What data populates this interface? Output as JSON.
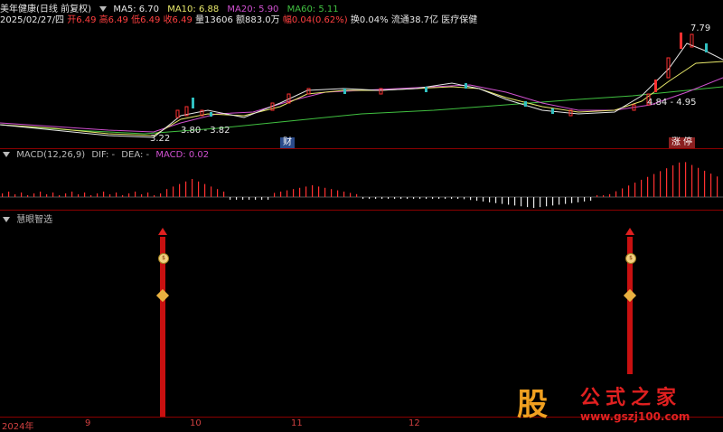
{
  "header": {
    "title": "美年健康(日线 前复权)",
    "ma5": "MA5: 6.70",
    "ma10": "MA10: 6.88",
    "ma20": "MA20: 5.90",
    "ma60": "MA60: 5.11",
    "date_line": "2025/02/27/四",
    "open": "开6.49",
    "high": "高6.49",
    "low": "低6.49",
    "close": "收6.49",
    "volume": "量13606",
    "amount": "额883.0万",
    "change": "幅0.04(0.62%)",
    "turnover": "换0.04%",
    "float": "流通38.7亿",
    "sector": "医疗保健"
  },
  "price_annotations": {
    "peak": "7.79",
    "low1": "3.22",
    "range1": "3.80 - 3.82",
    "range2": "4.84 - 4.95",
    "badge_cai": "财",
    "badge_zhangting": "涨",
    "badge_ting": "停"
  },
  "macd": {
    "label": "MACD(12,26,9)",
    "dif": "DIF: -",
    "dea": "DEA: -",
    "macd_value": "MACD: 0.02"
  },
  "indicator": {
    "label": "慧眼智选"
  },
  "x_axis": {
    "labels": [
      "2024年",
      "9",
      "10",
      "11",
      "12"
    ]
  },
  "watermark": {
    "chars": "股",
    "name": "公式之家",
    "url": "www.gszj100.com"
  },
  "colors": {
    "up": "#ff3030",
    "down": "#30c0c0",
    "ma5": "#e6e6e6",
    "ma10": "#e8e86a",
    "ma20": "#d050d0",
    "ma60": "#40c040",
    "signal": "#c81010"
  }
}
